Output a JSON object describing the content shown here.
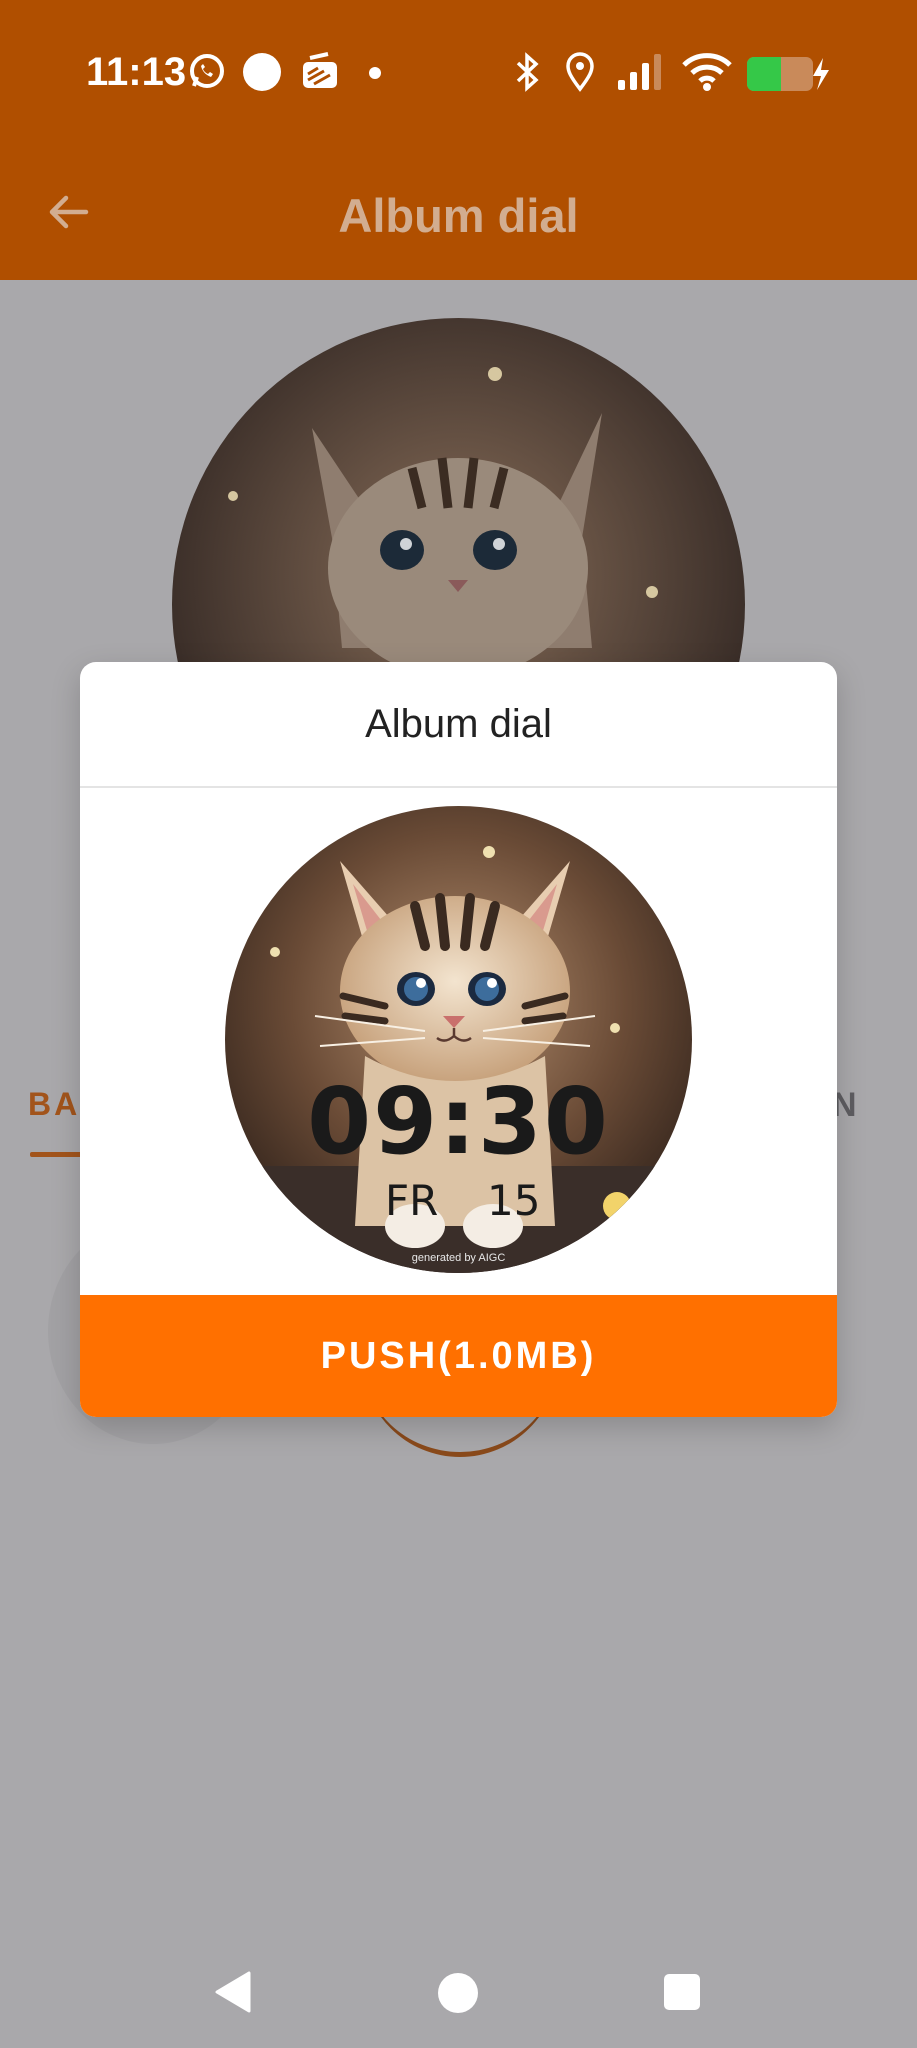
{
  "status_bar": {
    "time": "11:13",
    "icons": [
      "whatsapp-icon",
      "circle-icon",
      "stack-icon",
      "dot-icon",
      "bluetooth-icon",
      "location-icon",
      "signal-icon",
      "wifi-icon",
      "battery-charging-icon"
    ]
  },
  "app_bar": {
    "title": "Album dial",
    "back_icon": "arrow-left-icon"
  },
  "background": {
    "tab_left_label": "BAC",
    "tab_right_label": "N"
  },
  "dialog": {
    "title": "Album dial",
    "preview": {
      "time": "09:30",
      "day": "FR",
      "date": "15",
      "credit": "generated by AIGC"
    },
    "push_button_label": "PUSH(1.0MB)"
  },
  "nav_bar": {
    "icons": [
      "back-triangle-icon",
      "home-circle-icon",
      "recents-square-icon"
    ]
  },
  "colors": {
    "app_bar_dimmed": "#b04f00",
    "accent": "#ff7000",
    "scrim_background": "#a9a8ab"
  }
}
